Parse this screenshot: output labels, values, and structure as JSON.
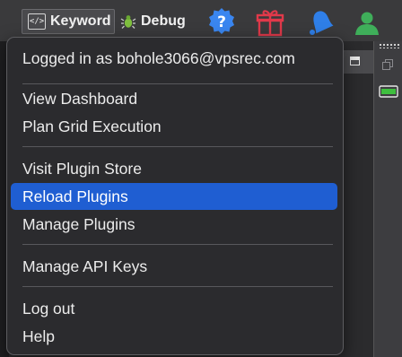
{
  "toolbar": {
    "keyword_label": "Keyword",
    "keyword_icon_text": "</>",
    "debug_label": "Debug",
    "icons": [
      "help-icon",
      "gift-icon",
      "notification-bell-icon",
      "user-icon"
    ]
  },
  "menu": {
    "logged_in": "Logged in as bohole3066@vpsrec.com",
    "items": [
      "View Dashboard",
      "Plan Grid Execution",
      "Visit Plugin Store",
      "Reload Plugins",
      "Manage Plugins",
      "Manage API Keys",
      "Log out",
      "Help"
    ],
    "highlighted": "Reload Plugins"
  },
  "colors": {
    "highlight": "#1f5ed2",
    "menu_bg": "#2b2b2e",
    "help_blue": "#3a86f0",
    "gift_red": "#e0394a",
    "bell_blue": "#2f7fe8",
    "user_green": "#3fae5a"
  }
}
